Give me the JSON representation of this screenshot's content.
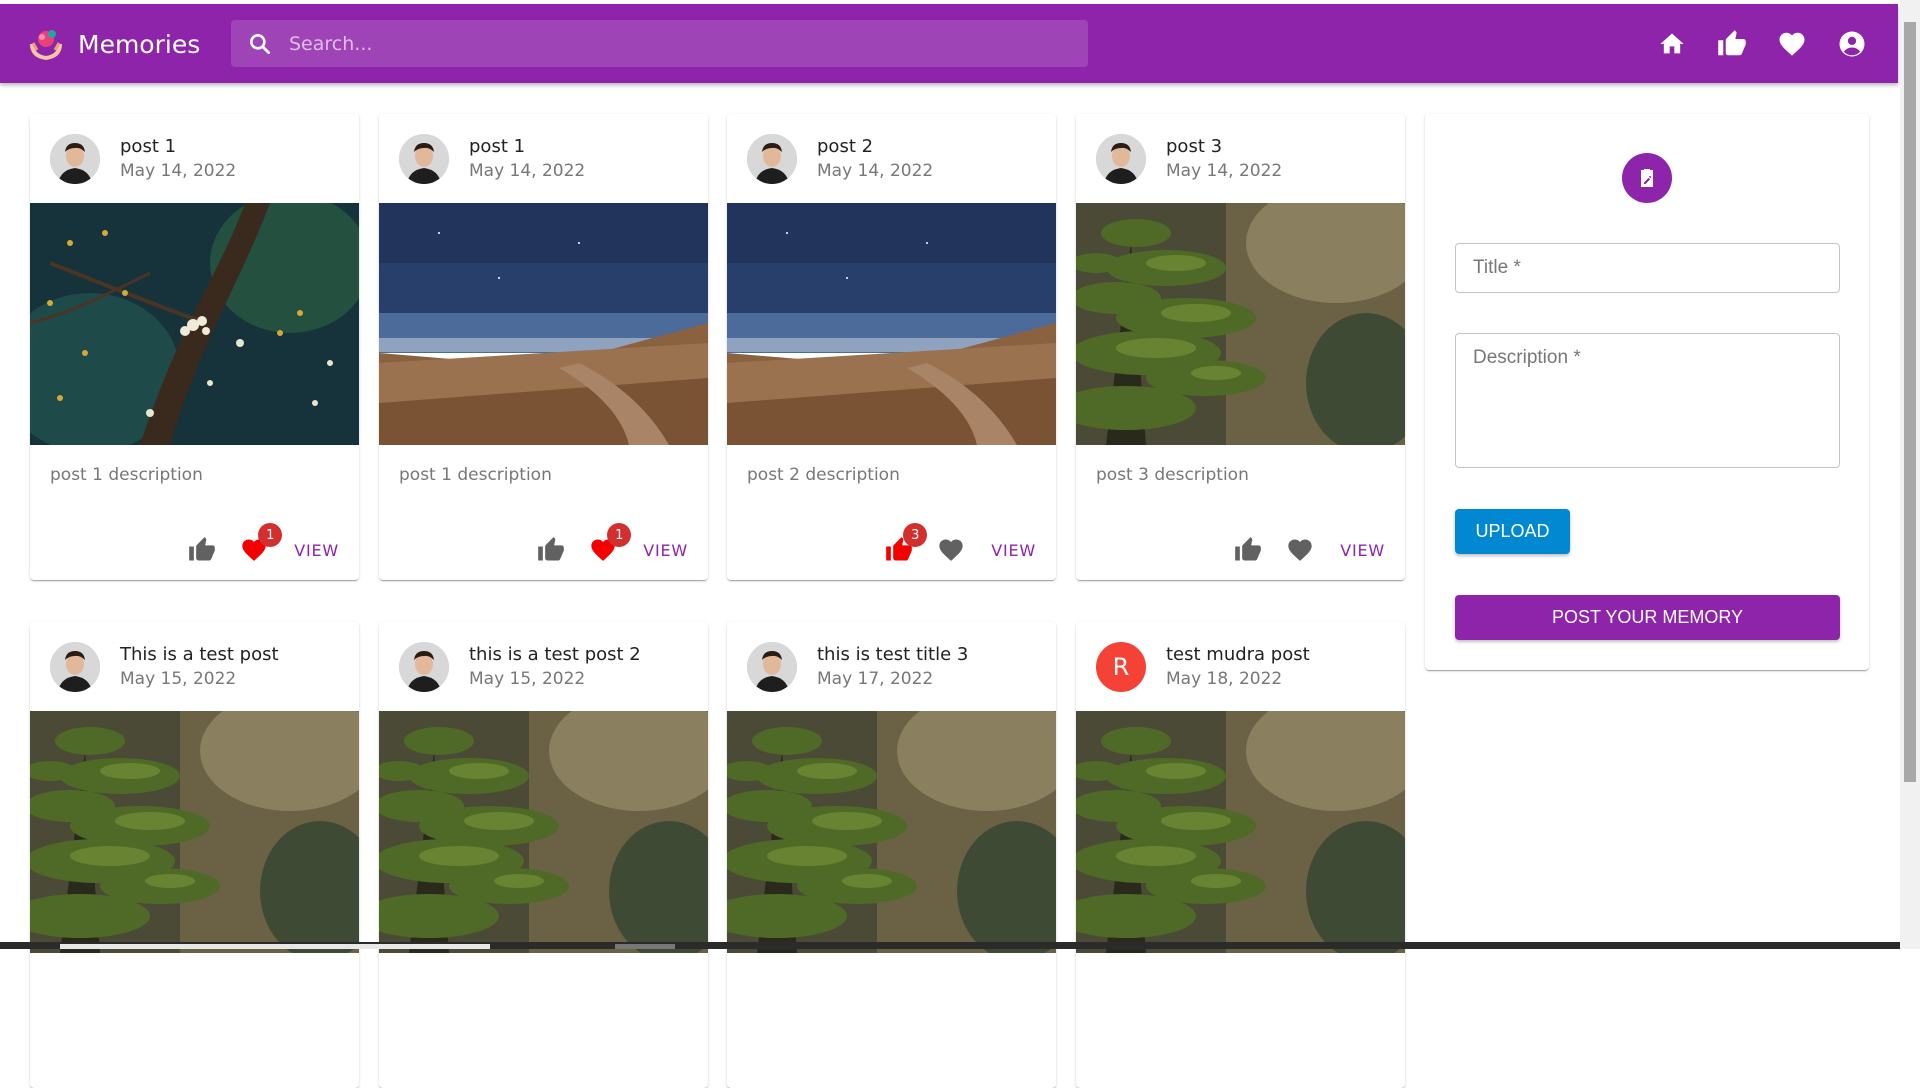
{
  "app": {
    "title": "Memories",
    "search_placeholder": "Search...",
    "nav": [
      "home-icon",
      "thumb-up-icon",
      "heart-icon",
      "account-icon"
    ]
  },
  "posts": [
    {
      "title": "post 1",
      "date": "May 14, 2022",
      "description": "post 1 description",
      "image": "blossom",
      "like_count": "",
      "fav_count": "1",
      "liked": false,
      "favorited": true,
      "view_label": "VIEW",
      "avatar_letter": ""
    },
    {
      "title": "post 1",
      "date": "May 14, 2022",
      "description": "post 1 description",
      "image": "desert",
      "like_count": "",
      "fav_count": "1",
      "liked": false,
      "favorited": true,
      "view_label": "VIEW",
      "avatar_letter": ""
    },
    {
      "title": "post 2",
      "date": "May 14, 2022",
      "description": "post 2 description",
      "image": "desert",
      "like_count": "3",
      "fav_count": "",
      "liked": true,
      "favorited": false,
      "view_label": "VIEW",
      "avatar_letter": ""
    },
    {
      "title": "post 3",
      "date": "May 14, 2022",
      "description": "post 3 description",
      "image": "forest",
      "like_count": "",
      "fav_count": "",
      "liked": false,
      "favorited": false,
      "view_label": "VIEW",
      "avatar_letter": ""
    },
    {
      "title": "This is a test post",
      "date": "May 15, 2022",
      "image": "forest",
      "avatar_letter": ""
    },
    {
      "title": "this is a test post 2",
      "date": "May 15, 2022",
      "image": "forest",
      "avatar_letter": ""
    },
    {
      "title": "this is test title 3",
      "date": "May 17, 2022",
      "image": "forest",
      "avatar_letter": ""
    },
    {
      "title": "test mudra post",
      "date": "May 18, 2022",
      "image": "forest",
      "avatar_letter": "R"
    }
  ],
  "form": {
    "title_placeholder": "Title *",
    "description_placeholder": "Description *",
    "upload_label": "UPLOAD",
    "submit_label": "POST YOUR MEMORY"
  },
  "colors": {
    "primary": "#8e24aa",
    "upload": "#0288d1",
    "badge": "#d32f2f",
    "liked": "#f40000",
    "icon_inactive": "#616161"
  }
}
